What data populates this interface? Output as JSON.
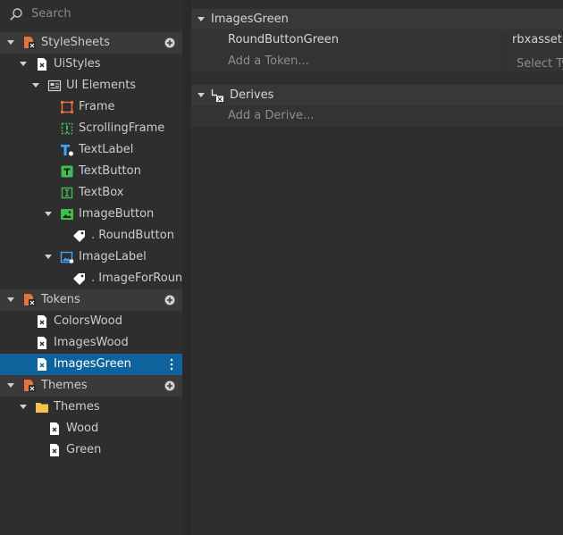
{
  "search": {
    "placeholder": "Search"
  },
  "tree": {
    "stylesheets": {
      "label": "StyleSheets",
      "uistyles": "UiStyles",
      "ui_elements": "UI Elements",
      "items": [
        "Frame",
        "ScrollingFrame",
        "TextLabel",
        "TextButton",
        "TextBox"
      ],
      "image_button": "ImageButton",
      "round_button": ". RoundButton",
      "image_label": "ImageLabel",
      "image_for_round": ". ImageForRound"
    },
    "tokens": {
      "label": "Tokens",
      "items": [
        "ColorsWood",
        "ImagesWood",
        "ImagesGreen"
      ]
    },
    "themes": {
      "label": "Themes",
      "folder": "Themes",
      "items": [
        "Wood",
        "Green"
      ]
    }
  },
  "editor": {
    "token_group": {
      "title": "ImagesGreen",
      "token_name": "RoundButtonGreen",
      "token_value": "rbxassetid://",
      "add_token": "Add a Token...",
      "select_type": "Select Type"
    },
    "derives_group": {
      "title": "Derives",
      "add_derive": "Add a Derive..."
    }
  },
  "colors": {
    "selected": "#0e639c",
    "stylesheet_icon": "#e8743b",
    "frame_icon": "#e8743b",
    "green_icon": "#3fbf4f",
    "blue_icon": "#3da7ff",
    "folder": "#f2c14e"
  },
  "icons": {
    "search": "magnifier-icon",
    "stylesheet": "stylesheet-icon",
    "style": "style-document-icon",
    "plus": "plus-circle-icon",
    "more": "vertical-ellipsis-icon",
    "tag": "tag-icon",
    "folder": "folder-icon",
    "derives": "derives-icon"
  }
}
